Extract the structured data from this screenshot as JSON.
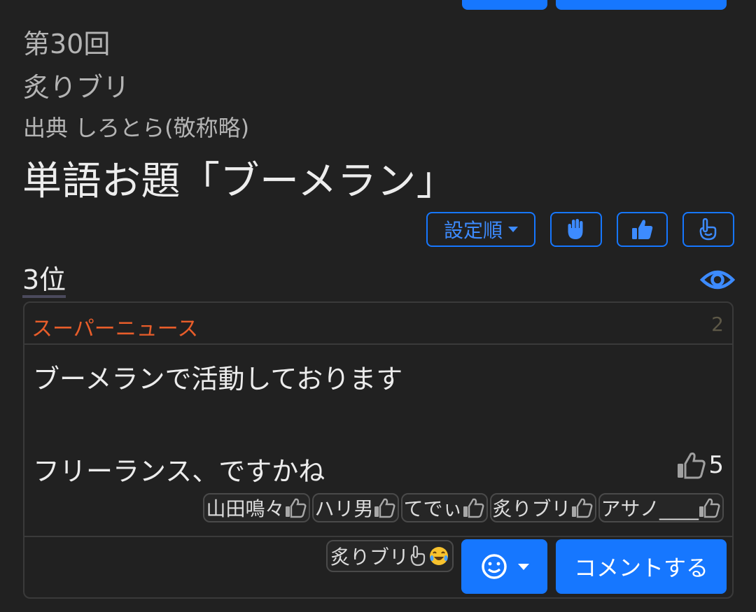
{
  "post": {
    "round": "第30回",
    "author": "炙りブリ",
    "source": "出典 しろとら(敬称略)",
    "title": "単語お題「ブーメラン」"
  },
  "controls": {
    "sort_label": "設定順",
    "icons": [
      "raised-hand-icon",
      "thumbs-up-icon",
      "pointing-hand-icon"
    ]
  },
  "entry": {
    "rank": "3位",
    "user": "スーパーニュース",
    "number": "2",
    "line1": "ブーメランで活動しております",
    "line2": "フリーランス、ですかね",
    "like_count": "5",
    "voters": [
      "山田鳴々",
      "ハリ男",
      "てでぃ",
      "炙りブリ",
      "アサノ____"
    ],
    "reaction_user": "炙りブリ"
  },
  "actions": {
    "comment_label": "コメントする"
  },
  "colors": {
    "accent": "#1677ff",
    "username": "#e85d2a",
    "background": "#212121"
  }
}
